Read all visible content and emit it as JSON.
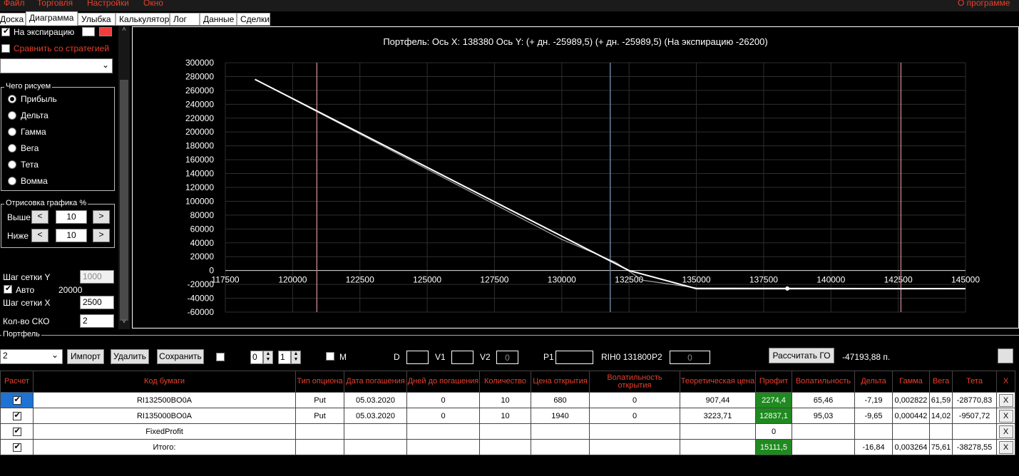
{
  "menu": {
    "file": "Файл",
    "trade": "Торговля",
    "settings": "Настройки",
    "window": "Окно",
    "about": "О программе"
  },
  "tabs": [
    "Доска",
    "Диаграмма",
    "Улыбка",
    "Калькулятор",
    "Лог",
    "Данные",
    "Сделки"
  ],
  "left": {
    "at_expiration": "На экспирацию",
    "compare": "Сравнить со стратегией",
    "what_title": "Чего рисуем",
    "radios": [
      "Прибыль",
      "Дельта",
      "Гамма",
      "Вега",
      "Тета",
      "Вомма"
    ],
    "draw_title": "Отрисовка графика %",
    "above": "Выше",
    "below": "Ниже",
    "above_val": "10",
    "below_val": "10",
    "prev": "<",
    "next": ">",
    "grid_y": "Шаг сетки Y",
    "grid_y_val": "1000",
    "auto": "Авто",
    "auto_val": "20000",
    "grid_x": "Шаг сетки X",
    "grid_x_val": "2500",
    "sko": "Кол-во СКО",
    "sko_val": "2",
    "colors": {
      "swatch1": "#ffffff",
      "swatch2": "#f03e3e"
    }
  },
  "chart_data": {
    "type": "line",
    "title": "Портфель: Ось X: 138380 Ось Y:  (+ дн. -25989,5)  (+ дн. -25989,5)  (На экспирацию -26200)",
    "xlim": [
      117500,
      145000
    ],
    "ylim": [
      -60000,
      300000
    ],
    "xticks": [
      117500,
      120000,
      122500,
      125000,
      127500,
      130000,
      132500,
      135000,
      137500,
      140000,
      142500,
      145000
    ],
    "yticks": [
      300000,
      280000,
      260000,
      240000,
      220000,
      200000,
      180000,
      160000,
      140000,
      120000,
      100000,
      80000,
      60000,
      40000,
      20000,
      0,
      -20000,
      -40000,
      -60000
    ],
    "grid": true,
    "series": [
      {
        "x": [
          118600,
          132500,
          135000,
          145000
        ],
        "y": [
          276000,
          0,
          -26200,
          -26200
        ],
        "color": "#ffffff"
      },
      {
        "x": [
          118600,
          130000,
          132000,
          133000,
          135000,
          145000
        ],
        "y": [
          276000,
          45000,
          12000,
          -14000,
          -25000,
          -25989.5
        ],
        "color": "#a0a0a0"
      }
    ],
    "vlines": [
      {
        "x": 120900,
        "color": "#b77a85"
      },
      {
        "x": 131800,
        "color": "#6a7f99"
      },
      {
        "x": 142600,
        "color": "#b77a85"
      }
    ],
    "marker": {
      "x": 138380,
      "y": -25989.5
    },
    "colors": {
      "grid": "#2e2e2e",
      "axis": "#d8d8d8",
      "tick_text": "#ffffff"
    }
  },
  "portfolio": {
    "title": "Портфель",
    "select_val": "2",
    "import": "Импорт",
    "delete": "Удалить",
    "save": "Сохранить",
    "spin1": "0",
    "spin2": "1",
    "m_label": "M",
    "d_label": "D",
    "v1_label": "V1",
    "v2_label": "V2",
    "v2_val": "0",
    "p1_label": "P1",
    "rih": "RIH0 131800",
    "p2_label": "P2",
    "p2_val": "0",
    "calc": "Рассчитать ГО",
    "go_val": "-47193,88 п."
  },
  "table": {
    "headers": [
      "Расчет",
      "Код бумаги",
      "Тип опциона",
      "Дата погашения",
      "Дней до погашения",
      "Количество",
      "Цена открытия",
      "Волатильность открытия",
      "Теоретическая цена",
      "Профит",
      "Волатильность",
      "Дельта",
      "Гамма",
      "Вега",
      "Тета",
      "X"
    ],
    "rows": [
      {
        "code": "RI132500BO0A",
        "type": "Put",
        "date": "05.03.2020",
        "days": "0",
        "qty": "10",
        "price": "680",
        "vol_open": "0",
        "theo": "907,44",
        "profit": "2274,4",
        "vol": "65,46",
        "delta": "-7,19",
        "gamma": "0,002822",
        "vega": "61,59",
        "theta": "-28770,83",
        "x": "X"
      },
      {
        "code": "RI135000BO0A",
        "type": "Put",
        "date": "05.03.2020",
        "days": "0",
        "qty": "10",
        "price": "1940",
        "vol_open": "0",
        "theo": "3223,71",
        "profit": "12837,1",
        "vol": "95,03",
        "delta": "-9,65",
        "gamma": "0,000442",
        "vega": "14,02",
        "theta": "-9507,72",
        "x": "X"
      },
      {
        "code": "FixedProfit",
        "type": "",
        "date": "",
        "days": "",
        "qty": "",
        "price": "",
        "vol_open": "",
        "theo": "",
        "profit": "0",
        "vol": "",
        "delta": "",
        "gamma": "",
        "vega": "",
        "theta": "",
        "x": "X"
      },
      {
        "code": "Итого:",
        "type": "",
        "date": "",
        "days": "",
        "qty": "",
        "price": "",
        "vol_open": "",
        "theo": "",
        "profit": "15111,5",
        "vol": "",
        "delta": "-16,84",
        "gamma": "0,003264",
        "vega": "75,61",
        "theta": "-38278,55",
        "x": "X"
      }
    ]
  }
}
